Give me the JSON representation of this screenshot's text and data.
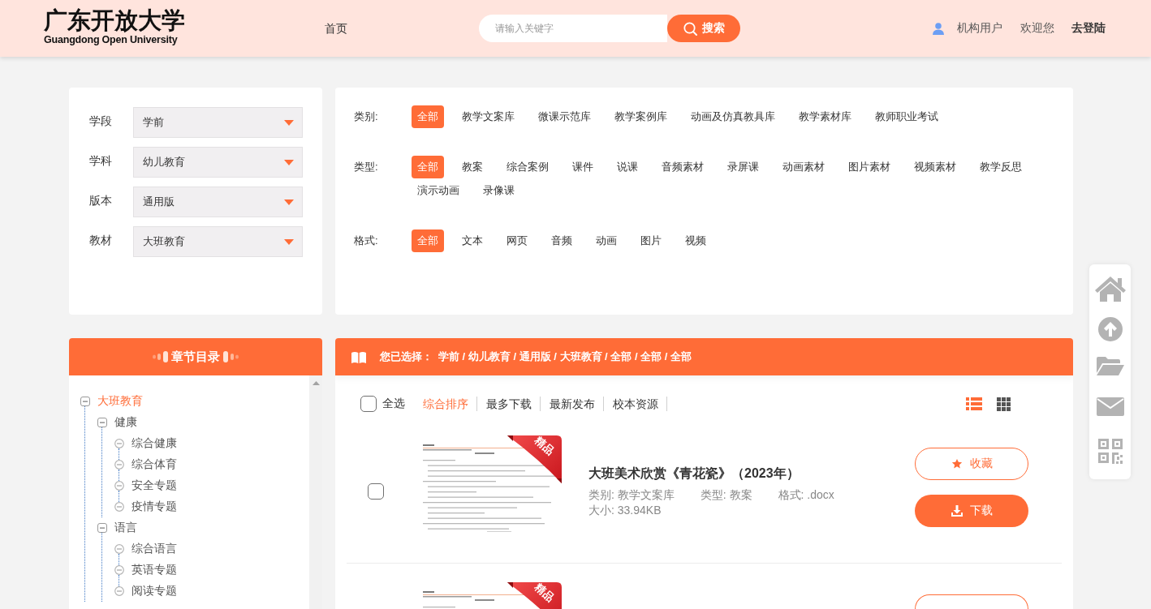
{
  "header": {
    "logo": {
      "title": "广东开放大学",
      "subtitle": "Guangdong Open University"
    },
    "nav": [
      "首页"
    ],
    "search": {
      "placeholder": "请输入关键字",
      "button": "搜索"
    },
    "user": {
      "role": "机构用户",
      "greeting": "欢迎您",
      "login": "去登陆"
    }
  },
  "selectors": [
    {
      "label": "学段",
      "value": "学前"
    },
    {
      "label": "学科",
      "value": "幼儿教育"
    },
    {
      "label": "版本",
      "value": "通用版"
    },
    {
      "label": "教材",
      "value": "大班教育"
    }
  ],
  "facets": [
    {
      "label": "类别:",
      "options": [
        {
          "label": "全部",
          "selected": true
        },
        {
          "label": "教学文案库",
          "selected": false
        },
        {
          "label": "微课示范库",
          "selected": false
        },
        {
          "label": "教学案例库",
          "selected": false
        },
        {
          "label": "动画及仿真教具库",
          "selected": false
        },
        {
          "label": "教学素材库",
          "selected": false
        },
        {
          "label": "教师职业考试",
          "selected": false
        }
      ]
    },
    {
      "label": "类型:",
      "options": [
        {
          "label": "全部",
          "selected": true
        },
        {
          "label": "教案",
          "selected": false
        },
        {
          "label": "综合案例",
          "selected": false
        },
        {
          "label": "课件",
          "selected": false
        },
        {
          "label": "说课",
          "selected": false
        },
        {
          "label": "音频素材",
          "selected": false
        },
        {
          "label": "录屏课",
          "selected": false
        },
        {
          "label": "动画素材",
          "selected": false
        },
        {
          "label": "图片素材",
          "selected": false
        },
        {
          "label": "视频素材",
          "selected": false
        },
        {
          "label": "教学反思",
          "selected": false
        },
        {
          "label": "演示动画",
          "selected": false
        },
        {
          "label": "录像课",
          "selected": false
        }
      ]
    },
    {
      "label": "格式:",
      "options": [
        {
          "label": "全部",
          "selected": true
        },
        {
          "label": "文本",
          "selected": false
        },
        {
          "label": "网页",
          "selected": false
        },
        {
          "label": "音频",
          "selected": false
        },
        {
          "label": "动画",
          "selected": false
        },
        {
          "label": "图片",
          "selected": false
        },
        {
          "label": "视频",
          "selected": false
        }
      ]
    }
  ],
  "chapters": {
    "title": "章节目录",
    "tree": [
      {
        "label": "大班教育",
        "selected": true,
        "expanded": true,
        "children": [
          {
            "label": "健康",
            "selected": false,
            "expanded": true,
            "children": [
              {
                "label": "综合健康",
                "selected": false
              },
              {
                "label": "综合体育",
                "selected": false
              },
              {
                "label": "安全专题",
                "selected": false
              },
              {
                "label": "疫情专题",
                "selected": false
              }
            ]
          },
          {
            "label": "语言",
            "selected": false,
            "expanded": true,
            "children": [
              {
                "label": "综合语言",
                "selected": false
              },
              {
                "label": "英语专题",
                "selected": false
              },
              {
                "label": "阅读专题",
                "selected": false
              }
            ]
          }
        ]
      }
    ]
  },
  "results": {
    "selection": {
      "label": "您已选择：",
      "path": "学前 / 幼儿教育 / 通用版 / 大班教育 / 全部 / 全部 / 全部"
    },
    "toolbar": {
      "select_all": {
        "label": "全选",
        "checked": false
      },
      "sorts": [
        {
          "label": "综合排序",
          "selected": true
        },
        {
          "label": "最多下载",
          "selected": false
        },
        {
          "label": "最新发布",
          "selected": false
        },
        {
          "label": "校本资源",
          "selected": false
        }
      ],
      "views": [
        {
          "kind": "list",
          "selected": true
        },
        {
          "kind": "grid",
          "selected": false
        }
      ]
    },
    "items": [
      {
        "kind": "full",
        "checked": false,
        "badge": "精品",
        "title": "大班美术欣赏《青花瓷》（2023年）",
        "meta": [
          "类别: 教学文案库",
          "类型: 教案",
          "格式: .docx"
        ],
        "size": "大小: 33.94KB",
        "actions": [
          {
            "kind": "collect",
            "label": "收藏"
          },
          {
            "kind": "download",
            "label": "下载"
          }
        ]
      },
      {
        "kind": "partial",
        "badge": "精品"
      }
    ]
  }
}
